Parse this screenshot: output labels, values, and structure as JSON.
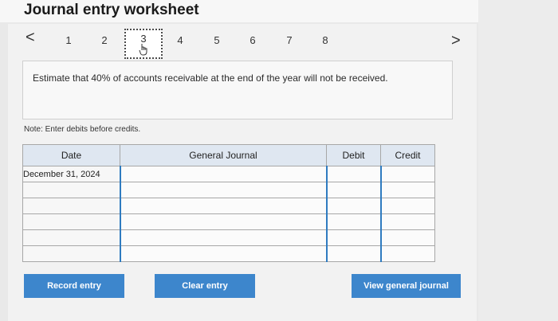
{
  "title": "Journal entry worksheet",
  "nav": {
    "prev_label": "<",
    "next_label": ">",
    "steps": [
      "1",
      "2",
      "3",
      "4",
      "5",
      "6",
      "7",
      "8"
    ],
    "active_step": "3"
  },
  "prompt": "Estimate that 40% of accounts receivable at the end of the year will not be received.",
  "note": "Note: Enter debits before credits.",
  "table": {
    "headers": [
      "Date",
      "General Journal",
      "Debit",
      "Credit"
    ],
    "rows": [
      {
        "date": "December 31, 2024",
        "account": "",
        "debit": "",
        "credit": ""
      },
      {
        "date": "",
        "account": "",
        "debit": "",
        "credit": ""
      },
      {
        "date": "",
        "account": "",
        "debit": "",
        "credit": ""
      },
      {
        "date": "",
        "account": "",
        "debit": "",
        "credit": ""
      },
      {
        "date": "",
        "account": "",
        "debit": "",
        "credit": ""
      },
      {
        "date": "",
        "account": "",
        "debit": "",
        "credit": ""
      }
    ]
  },
  "buttons": {
    "record": "Record entry",
    "clear": "Clear entry",
    "view": "View general journal"
  }
}
